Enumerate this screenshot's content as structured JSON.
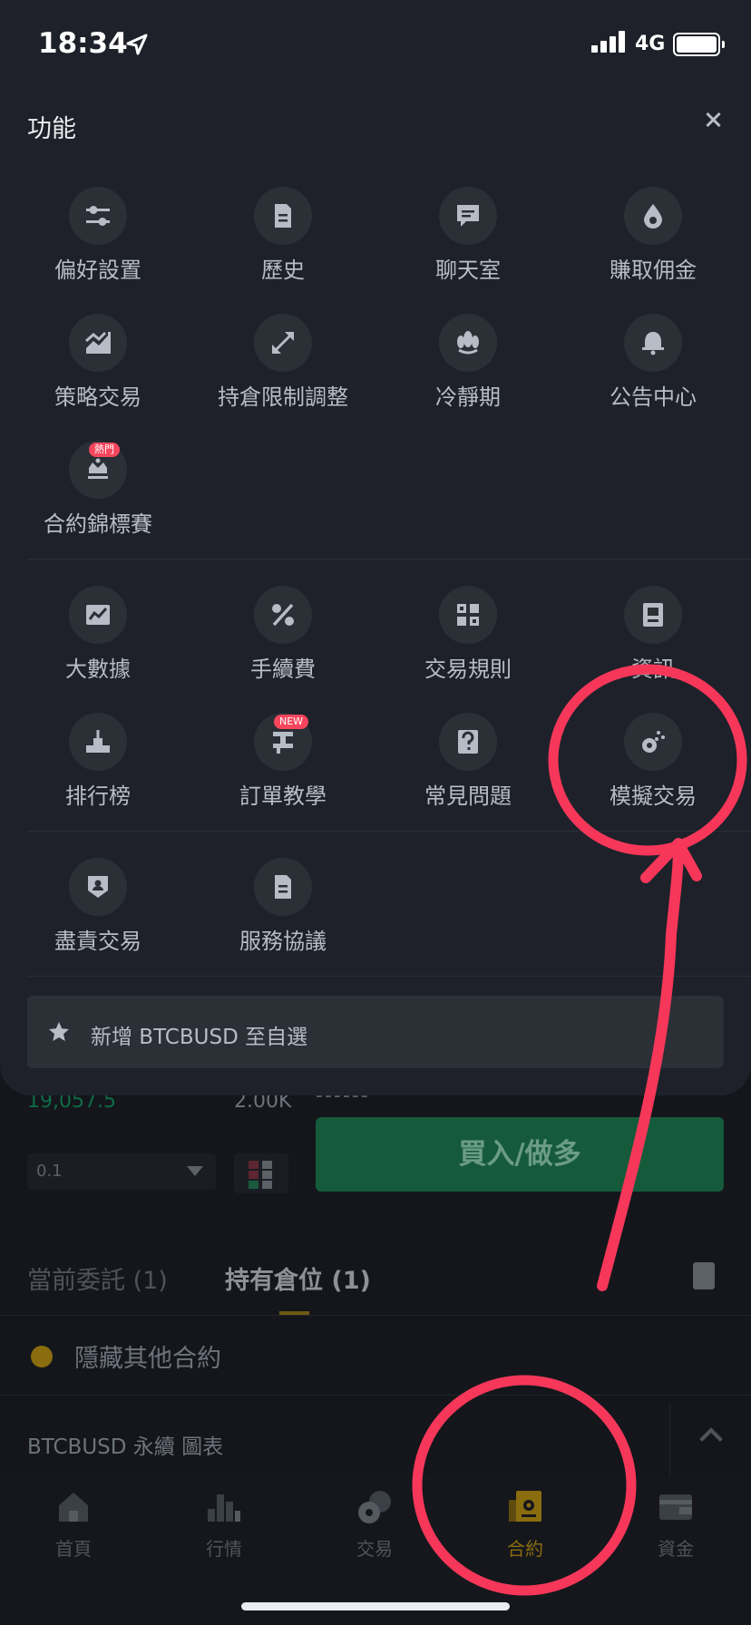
{
  "status_bar": {
    "time": "18:34",
    "network": "4G"
  },
  "panel": {
    "title": "功能",
    "group1": [
      {
        "label": "偏好設置",
        "icon": "sliders-icon"
      },
      {
        "label": "歷史",
        "icon": "document-icon"
      },
      {
        "label": "聊天室",
        "icon": "chat-icon"
      },
      {
        "label": "賺取佣金",
        "icon": "droplet-icon"
      },
      {
        "label": "策略交易",
        "icon": "chart-trend-icon"
      },
      {
        "label": "持倉限制調整",
        "icon": "expand-arrows-icon"
      },
      {
        "label": "冷靜期",
        "icon": "lotus-icon"
      },
      {
        "label": "公告中心",
        "icon": "bell-icon"
      },
      {
        "label": "合約錦標賽",
        "icon": "trophy-icon",
        "badge": "熱門"
      }
    ],
    "group2": [
      {
        "label": "大數據",
        "icon": "line-chart-icon"
      },
      {
        "label": "手續費",
        "icon": "percent-icon"
      },
      {
        "label": "交易規則",
        "icon": "grid-icon"
      },
      {
        "label": "資訊",
        "icon": "info-card-icon"
      },
      {
        "label": "排行榜",
        "icon": "podium-icon"
      },
      {
        "label": "訂單教學",
        "icon": "tutorial-icon",
        "badge": "NEW"
      },
      {
        "label": "常見問題",
        "icon": "question-icon"
      },
      {
        "label": "模擬交易",
        "icon": "simulated-trading-icon"
      }
    ],
    "group3": [
      {
        "label": "盡責交易",
        "icon": "shield-icon"
      },
      {
        "label": "服務協議",
        "icon": "agreement-icon"
      }
    ],
    "favorite_label": "新增 BTCBUSD 至自選"
  },
  "background": {
    "price": "19,057.5",
    "volume": "2.00K",
    "dashes": "------",
    "quantity": "0.1",
    "buy_label": "買入/做多",
    "tabs": [
      "當前委託 (1)",
      "持有倉位 (1)"
    ],
    "hide_other": "隱藏其他合約",
    "symbol_line": "BTCBUSD 永續  圖表"
  },
  "bottom_nav": [
    {
      "label": "首頁",
      "icon": "home-icon"
    },
    {
      "label": "行情",
      "icon": "market-icon"
    },
    {
      "label": "交易",
      "icon": "trade-icon"
    },
    {
      "label": "合約",
      "icon": "futures-icon",
      "active": true
    },
    {
      "label": "資金",
      "icon": "wallet-icon"
    }
  ],
  "colors": {
    "accent": "#f0b90b",
    "annotation": "#f6375a",
    "buy": "#0ecb81",
    "panel": "#1e2129"
  }
}
